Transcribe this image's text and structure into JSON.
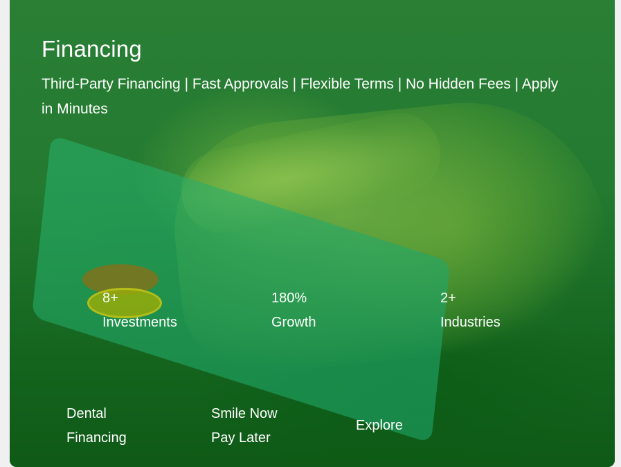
{
  "card": {
    "title": "Financing",
    "subtitle": "Third-Party Financing | Fast Approvals | Flexible Terms | No Hidden Fees | Apply in Minutes",
    "background_image": "green-tinted-hand-holding-credit-card",
    "overlay_color": "#1a7a2e"
  },
  "stats": [
    {
      "value": "8+",
      "label": "Investments"
    },
    {
      "value": "180%",
      "label": "Growth"
    },
    {
      "value": "2+",
      "label": "Industries"
    }
  ],
  "links": [
    {
      "line1": "Dental",
      "line2": "Financing"
    },
    {
      "line1": "Smile Now",
      "line2": "Pay Later"
    },
    {
      "line1": "Explore"
    }
  ]
}
